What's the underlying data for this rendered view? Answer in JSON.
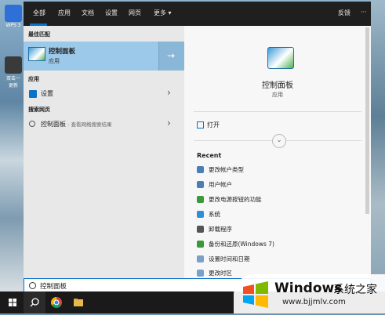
{
  "desktop": {
    "icons": [
      {
        "label": "WPS 3"
      },
      {
        "label": "双击一"
      },
      {
        "label": "更新"
      }
    ]
  },
  "topbar": {
    "tabs": [
      "全部",
      "应用",
      "文档",
      "设置",
      "网页",
      "更多 ▾"
    ],
    "active_tab": "全部",
    "feedback": "反馈",
    "more": "···"
  },
  "left": {
    "best_match_header": "最佳匹配",
    "best_match": {
      "name": "控制面板",
      "type": "应用"
    },
    "apps_header": "应用",
    "apps": [
      {
        "label": "设置"
      }
    ],
    "web_header": "搜索网页",
    "web": [
      {
        "label": "控制面板",
        "hint": " - 查看网络搜索结果"
      }
    ]
  },
  "right": {
    "title": "控制面板",
    "subtitle": "应用",
    "open_label": "打开",
    "expand_icon": "chevron-down-icon",
    "recent_header": "Recent",
    "recent": [
      {
        "label": "更改帐户类型",
        "icon": "users-icon",
        "color": "#4a7fb5"
      },
      {
        "label": "用户帐户",
        "icon": "users-icon",
        "color": "#4a7fb5"
      },
      {
        "label": "更改电源按钮的功能",
        "icon": "power-icon",
        "color": "#3a9a3a"
      },
      {
        "label": "系统",
        "icon": "monitor-icon",
        "color": "#2f8fd6"
      },
      {
        "label": "卸载程序",
        "icon": "uninstall-icon",
        "color": "#555555"
      },
      {
        "label": "备份和还原(Windows 7)",
        "icon": "backup-icon",
        "color": "#3a9a3a"
      },
      {
        "label": "设置时间和日期",
        "icon": "clock-icon",
        "color": "#7aa0c8"
      },
      {
        "label": "更改时区",
        "icon": "clock-icon",
        "color": "#7aa0c8"
      }
    ]
  },
  "search": {
    "value": "控制面板"
  },
  "watermark": {
    "brand": "Windows",
    "cn": "系统之家",
    "url": "www.bjjmlv.com"
  },
  "colors": {
    "accent": "#0a72c8",
    "selected": "#9cc8ea",
    "topbar": "#1f1f1f"
  }
}
